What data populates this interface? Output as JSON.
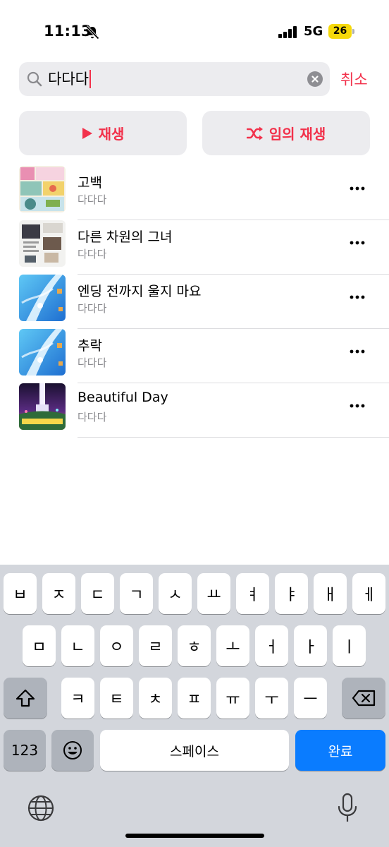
{
  "status": {
    "time": "11:13",
    "network": "5G",
    "battery": "26"
  },
  "search": {
    "query": "다다다",
    "cancel_label": "취소"
  },
  "actions": {
    "play_label": "재생",
    "shuffle_label": "임의 재생"
  },
  "songs": [
    {
      "title": "고백",
      "artist": "다다다"
    },
    {
      "title": "다른 차원의 그녀",
      "artist": "다다다"
    },
    {
      "title": "엔딩 전까지 울지 마요",
      "artist": "다다다"
    },
    {
      "title": "추락",
      "artist": "다다다"
    },
    {
      "title": "Beautiful Day",
      "artist": "다다다"
    }
  ],
  "keyboard": {
    "row1": [
      "ㅂ",
      "ㅈ",
      "ㄷ",
      "ㄱ",
      "ㅅ",
      "ㅛ",
      "ㅕ",
      "ㅑ",
      "ㅐ",
      "ㅔ"
    ],
    "row2": [
      "ㅁ",
      "ㄴ",
      "ㅇ",
      "ㄹ",
      "ㅎ",
      "ㅗ",
      "ㅓ",
      "ㅏ",
      "ㅣ"
    ],
    "row3": [
      "ㅋ",
      "ㅌ",
      "ㅊ",
      "ㅍ",
      "ㅠ",
      "ㅜ",
      "ㅡ"
    ],
    "numbers_label": "123",
    "space_label": "스페이스",
    "done_label": "완료"
  },
  "colors": {
    "accent": "#f2314b",
    "done_key": "#0a7cff",
    "battery": "#f6d90a"
  }
}
